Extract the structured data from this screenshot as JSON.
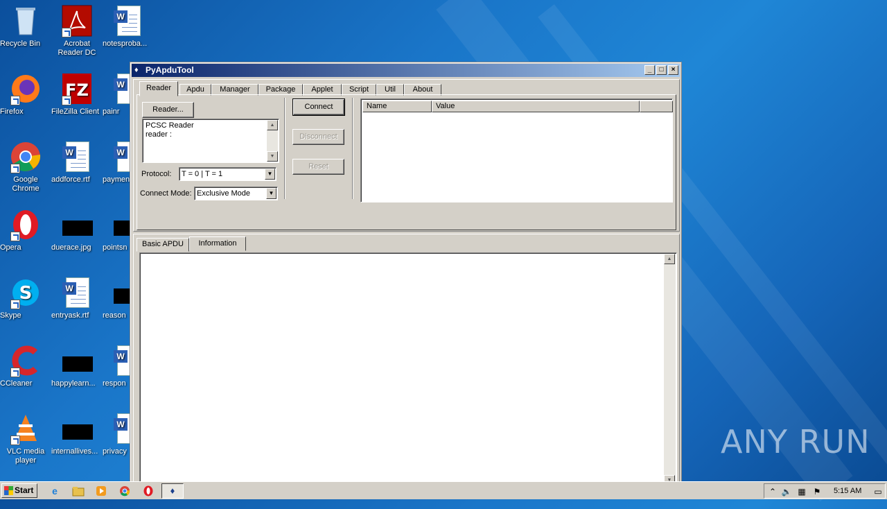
{
  "desktop": {
    "icons": [
      {
        "label": "Recycle Bin",
        "icon": "recycle-bin-icon"
      },
      {
        "label": "Acrobat Reader DC",
        "icon": "acrobat-icon"
      },
      {
        "label": "notesproba...",
        "icon": "word-doc-icon"
      },
      {
        "label": "Firefox",
        "icon": "firefox-icon"
      },
      {
        "label": "FileZilla Client",
        "icon": "filezilla-icon"
      },
      {
        "label": "painr",
        "icon": "word-doc-icon"
      },
      {
        "label": "Google Chrome",
        "icon": "chrome-icon"
      },
      {
        "label": "addforce.rtf",
        "icon": "word-doc-icon"
      },
      {
        "label": "paymen",
        "icon": "word-doc-icon"
      },
      {
        "label": "Opera",
        "icon": "opera-icon"
      },
      {
        "label": "duerace.jpg",
        "icon": "image-icon"
      },
      {
        "label": "pointsn",
        "icon": "image-icon"
      },
      {
        "label": "Skype",
        "icon": "skype-icon"
      },
      {
        "label": "entryask.rtf",
        "icon": "word-doc-icon"
      },
      {
        "label": "reason",
        "icon": "image-icon"
      },
      {
        "label": "CCleaner",
        "icon": "ccleaner-icon"
      },
      {
        "label": "happylearn...",
        "icon": "image-icon"
      },
      {
        "label": "respon",
        "icon": "word-doc-icon"
      },
      {
        "label": "VLC media player",
        "icon": "vlc-icon"
      },
      {
        "label": "internallives...",
        "icon": "image-icon"
      },
      {
        "label": "privacy",
        "icon": "word-doc-icon"
      }
    ]
  },
  "window": {
    "title": "PyApduTool",
    "top_tabs": [
      "Reader",
      "Apdu",
      "Manager",
      "Package",
      "Applet",
      "Script",
      "Util",
      "About"
    ],
    "reader": {
      "reader_button": "Reader...",
      "reader_text_line1": "PCSC Reader",
      "reader_text_line2": "reader :",
      "protocol_label": "Protocol:",
      "protocol_value": "T = 0 | T = 1",
      "connect_mode_label": "Connect Mode:",
      "connect_mode_value": "Exclusive Mode",
      "connect_button": "Connect",
      "disconnect_button": "Disconnect",
      "reset_button": "Reset",
      "columns": [
        "Name",
        "Value"
      ]
    },
    "bottom_tabs": [
      "Basic APDU",
      "Information"
    ]
  },
  "taskbar": {
    "start_label": "Start",
    "clock": "5:15 AM",
    "apps": [
      "ie-icon",
      "explorer-icon",
      "media-player-icon",
      "chrome-icon",
      "opera-icon",
      "pyapdutool-icon"
    ]
  },
  "watermark": "ANY RUN",
  "colors": {
    "titlebar_start": "#0a246a",
    "titlebar_end": "#a6caf0",
    "window_face": "#d4d0c8",
    "desktop": "#1f86d6"
  }
}
